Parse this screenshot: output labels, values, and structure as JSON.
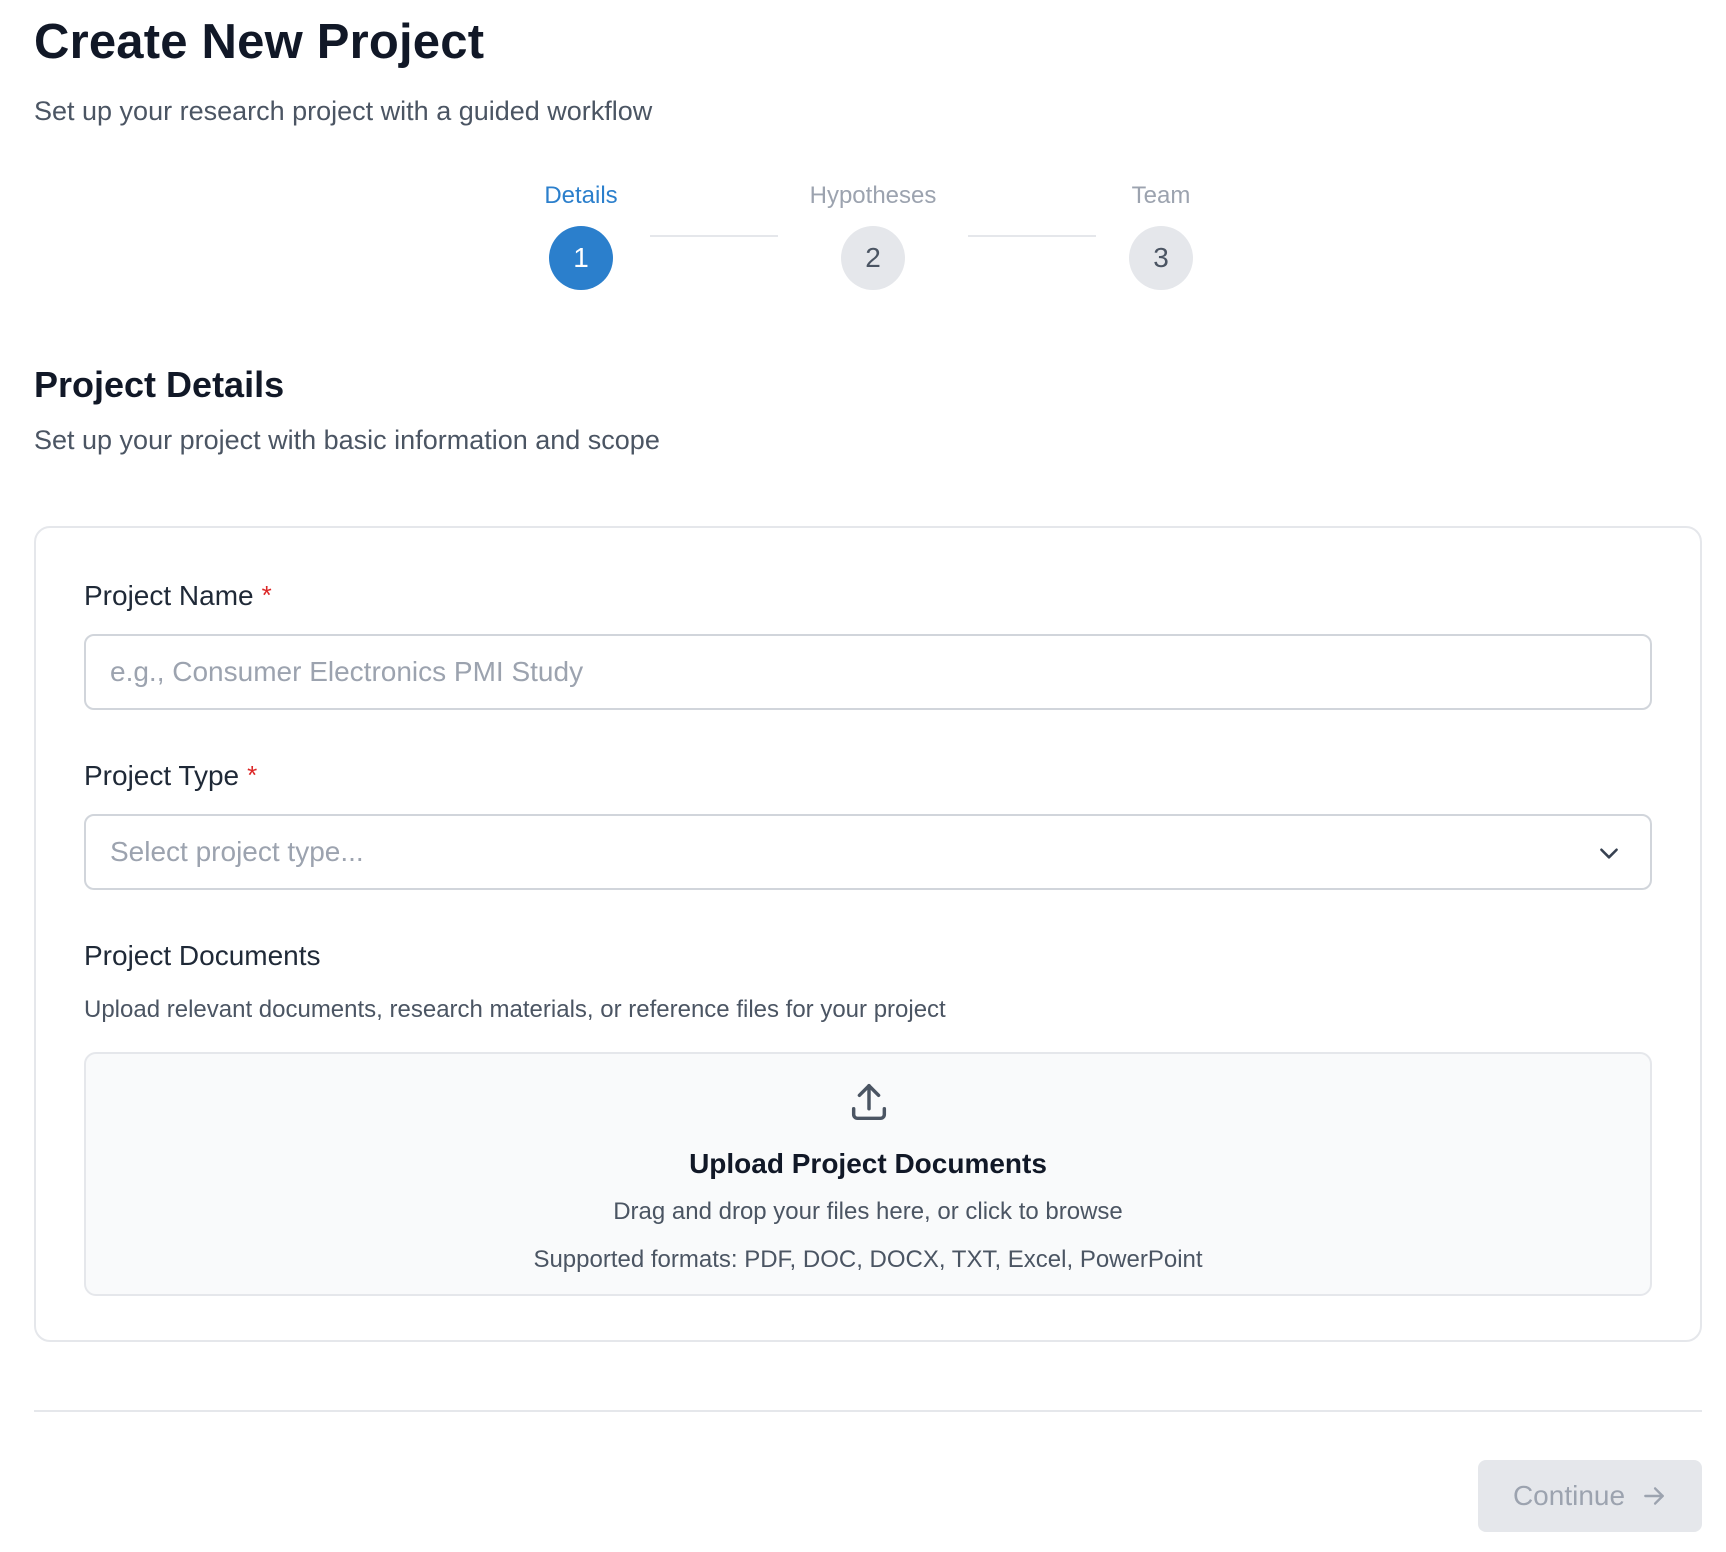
{
  "header": {
    "title": "Create New Project",
    "subtitle": "Set up your research project with a guided workflow"
  },
  "stepper": {
    "steps": [
      {
        "label": "Details",
        "number": "1",
        "active": true
      },
      {
        "label": "Hypotheses",
        "number": "2",
        "active": false
      },
      {
        "label": "Team",
        "number": "3",
        "active": false
      }
    ]
  },
  "section": {
    "title": "Project Details",
    "subtitle": "Set up your project with basic information and scope"
  },
  "form": {
    "project_name": {
      "label": "Project Name",
      "required_mark": "*",
      "value": "",
      "placeholder": "e.g., Consumer Electronics PMI Study"
    },
    "project_type": {
      "label": "Project Type",
      "required_mark": "*",
      "selected": "Select project type..."
    },
    "documents": {
      "label": "Project Documents",
      "help": "Upload relevant documents, research materials, or reference files for your project",
      "dropzone_title": "Upload Project Documents",
      "dropzone_subtitle": "Drag and drop your files here, or click to browse",
      "dropzone_formats": "Supported formats: PDF, DOC, DOCX, TXT, Excel, PowerPoint"
    }
  },
  "footer": {
    "continue_label": "Continue"
  },
  "icons": {
    "chevron": "chevron-down-icon",
    "upload": "upload-icon",
    "arrow": "arrow-right-icon"
  },
  "colors": {
    "accent": "#2b7fcc",
    "required": "#dc2626",
    "inactive_step": "#e5e7eb",
    "disabled_button": "#e5e7eb"
  }
}
